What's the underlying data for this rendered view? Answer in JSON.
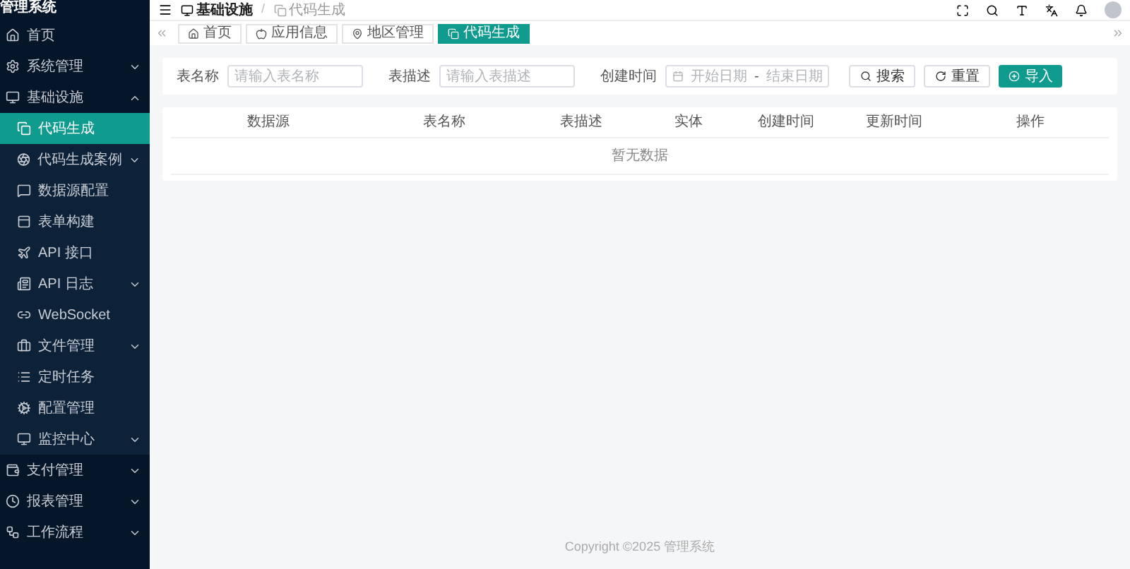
{
  "app": {
    "title": "管理系统"
  },
  "sidebar": {
    "items": [
      {
        "label": "首页",
        "selected": false
      },
      {
        "label": "系统管理",
        "selected": false,
        "expanded": false
      },
      {
        "label": "基础设施",
        "selected": false,
        "expanded": true,
        "children": [
          {
            "label": "代码生成",
            "selected": true
          },
          {
            "label": "代码生成案例",
            "selected": false,
            "expanded": false
          },
          {
            "label": "数据源配置",
            "selected": false
          },
          {
            "label": "表单构建",
            "selected": false
          },
          {
            "label": "API 接口",
            "selected": false
          },
          {
            "label": "API 日志",
            "selected": false,
            "expanded": false
          },
          {
            "label": "WebSocket",
            "selected": false
          },
          {
            "label": "文件管理",
            "selected": false,
            "expanded": false
          },
          {
            "label": "定时任务",
            "selected": false
          },
          {
            "label": "配置管理",
            "selected": false
          },
          {
            "label": "监控中心",
            "selected": false,
            "expanded": false
          }
        ]
      },
      {
        "label": "支付管理",
        "selected": false,
        "expanded": false
      },
      {
        "label": "报表管理",
        "selected": false,
        "expanded": false
      },
      {
        "label": "工作流程",
        "selected": false,
        "expanded": false
      }
    ]
  },
  "breadcrumb": [
    "基础设施",
    "代码生成"
  ],
  "breadcrumb_separator": "/",
  "tabs": [
    {
      "label": "首页",
      "selected": false
    },
    {
      "label": "应用信息",
      "selected": false
    },
    {
      "label": "地区管理",
      "selected": false
    },
    {
      "label": "代码生成",
      "selected": true
    }
  ],
  "search_form": {
    "fields": [
      {
        "label": "表名称",
        "placeholder": "请输入表名称"
      },
      {
        "label": "表描述",
        "placeholder": "请输入表描述"
      }
    ],
    "date_range": {
      "label": "创建时间",
      "start_placeholder": "开始日期",
      "separator": "-",
      "end_placeholder": "结束日期"
    },
    "buttons": [
      {
        "label": "搜索",
        "kind": "search"
      },
      {
        "label": "重置",
        "kind": "reset"
      },
      {
        "label": "导入",
        "kind": "import"
      }
    ]
  },
  "table": {
    "columns": [
      "数据源",
      "表名称",
      "表描述",
      "实体",
      "创建时间",
      "更新时间",
      "操作"
    ],
    "empty_text": "暂无数据"
  },
  "footer": {
    "text": "Copyright ©2025 管理系统"
  }
}
